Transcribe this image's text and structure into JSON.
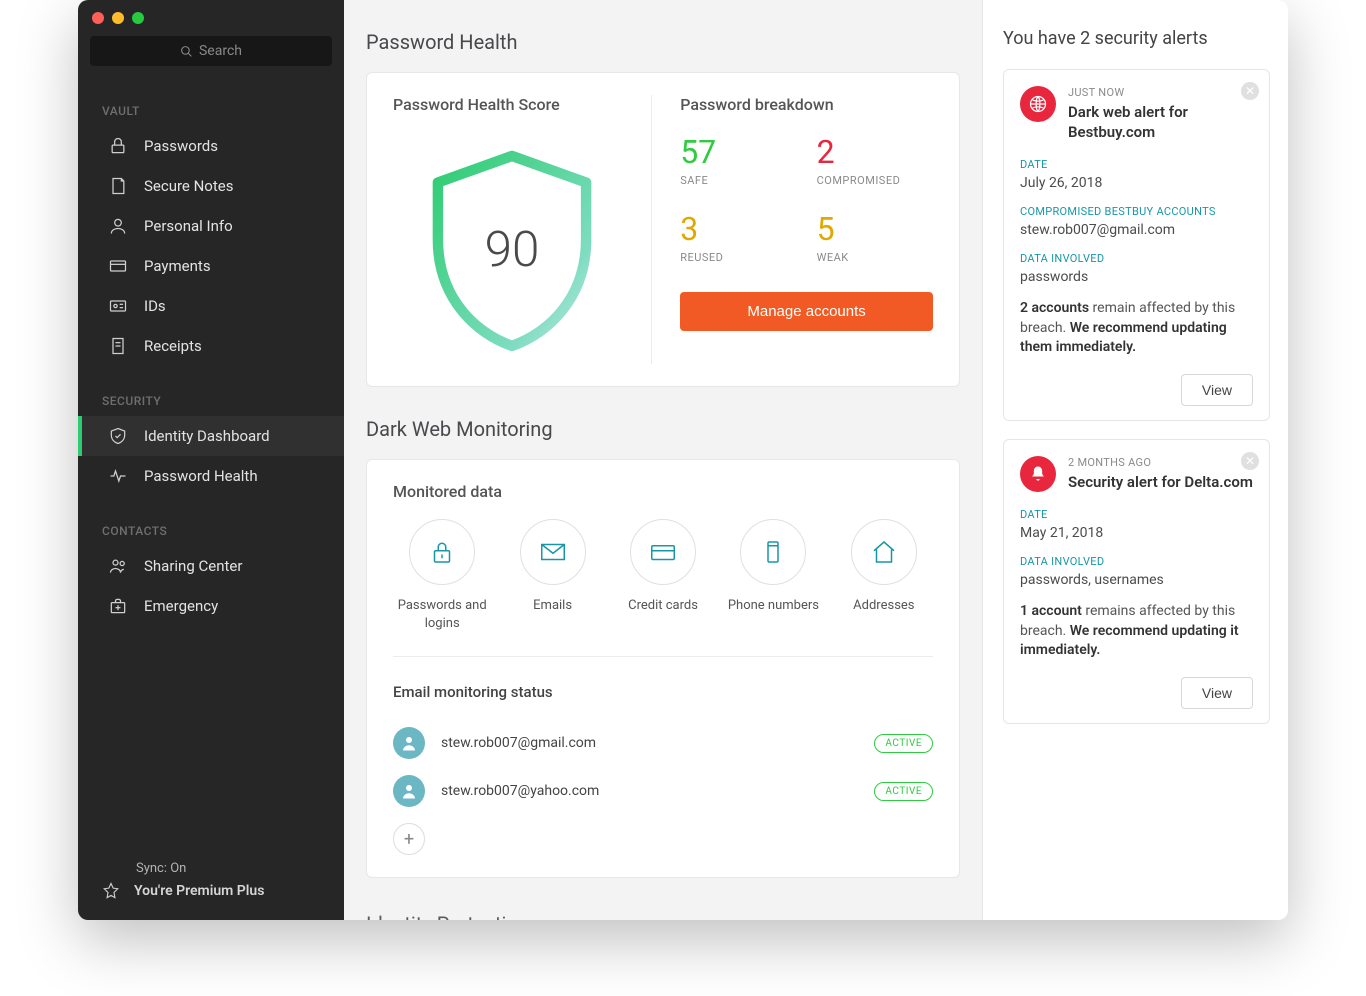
{
  "search": {
    "placeholder": "Search"
  },
  "sidebar": {
    "sections": [
      {
        "header": "VAULT",
        "items": [
          {
            "label": "Passwords",
            "icon": "lock-icon"
          },
          {
            "label": "Secure Notes",
            "icon": "note-icon"
          },
          {
            "label": "Personal Info",
            "icon": "person-icon"
          },
          {
            "label": "Payments",
            "icon": "card-icon"
          },
          {
            "label": "IDs",
            "icon": "id-icon"
          },
          {
            "label": "Receipts",
            "icon": "receipt-icon"
          }
        ]
      },
      {
        "header": "SECURITY",
        "items": [
          {
            "label": "Identity Dashboard",
            "icon": "shield-icon",
            "active": true
          },
          {
            "label": "Password Health",
            "icon": "pulse-icon"
          }
        ]
      },
      {
        "header": "CONTACTS",
        "items": [
          {
            "label": "Sharing Center",
            "icon": "people-icon"
          },
          {
            "label": "Emergency",
            "icon": "kit-icon"
          }
        ]
      }
    ],
    "sync": "Sync: On",
    "premium": "You're Premium Plus"
  },
  "passwordHealth": {
    "title": "Password Health",
    "scoreTitle": "Password Health Score",
    "score": "90",
    "breakdownTitle": "Password breakdown",
    "breakdown": {
      "safe": {
        "num": "57",
        "label": "SAFE"
      },
      "compromised": {
        "num": "2",
        "label": "COMPROMISED"
      },
      "reused": {
        "num": "3",
        "label": "REUSED"
      },
      "weak": {
        "num": "5",
        "label": "WEAK"
      }
    },
    "manageBtn": "Manage accounts"
  },
  "darkWeb": {
    "title": "Dark Web Monitoring",
    "monTitle": "Monitored data",
    "items": [
      {
        "label": "Passwords and logins"
      },
      {
        "label": "Emails"
      },
      {
        "label": "Credit cards"
      },
      {
        "label": "Phone numbers"
      },
      {
        "label": "Addresses"
      }
    ],
    "emailStatusTitle": "Email monitoring status",
    "emails": [
      {
        "addr": "stew.rob007@gmail.com",
        "status": "ACTIVE"
      },
      {
        "addr": "stew.rob007@yahoo.com",
        "status": "ACTIVE"
      }
    ]
  },
  "identityProtection": {
    "title": "Identity Protection"
  },
  "alerts": {
    "title": "You have 2 security alerts",
    "items": [
      {
        "time": "JUST NOW",
        "subject": "Dark web alert for Bestbuy.com",
        "dateLabel": "DATE",
        "date": "July 26, 2018",
        "compromisedLabel": "COMPROMISED BESTBUY ACCOUNTS",
        "compromised": "stew.rob007@gmail.com",
        "dataLabel": "DATA INVOLVED",
        "data": "passwords",
        "msgCount": "2 accounts",
        "msgRest": " remain affected by this breach. ",
        "msgBold": "We recommend updating them immediately.",
        "viewLabel": "View"
      },
      {
        "time": "2 MONTHS AGO",
        "subject": "Security alert for Delta.com",
        "dateLabel": "DATE",
        "date": "May 21, 2018",
        "dataLabel": "DATA INVOLVED",
        "data": "passwords, usernames",
        "msgCount": "1 account",
        "msgRest": " remains affected by this breach. ",
        "msgBold": "We recommend updating it immediately.",
        "viewLabel": "View"
      }
    ]
  }
}
